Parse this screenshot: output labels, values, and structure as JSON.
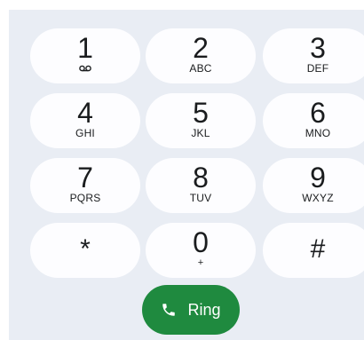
{
  "keypad": {
    "keys": [
      {
        "digit": "1",
        "sub": "voicemail-icon"
      },
      {
        "digit": "2",
        "sub": "ABC"
      },
      {
        "digit": "3",
        "sub": "DEF"
      },
      {
        "digit": "4",
        "sub": "GHI"
      },
      {
        "digit": "5",
        "sub": "JKL"
      },
      {
        "digit": "6",
        "sub": "MNO"
      },
      {
        "digit": "7",
        "sub": "PQRS"
      },
      {
        "digit": "8",
        "sub": "TUV"
      },
      {
        "digit": "9",
        "sub": "WXYZ"
      },
      {
        "digit": "*",
        "sub": ""
      },
      {
        "digit": "0",
        "sub": "+"
      },
      {
        "digit": "#",
        "sub": ""
      }
    ]
  },
  "call_button": {
    "label": "Ring",
    "icon": "phone-icon",
    "color": "#1f8a3f"
  },
  "colors": {
    "panel_bg": "#e9edf4",
    "key_bg": "#fdfdff",
    "text": "#1a1c1e"
  }
}
